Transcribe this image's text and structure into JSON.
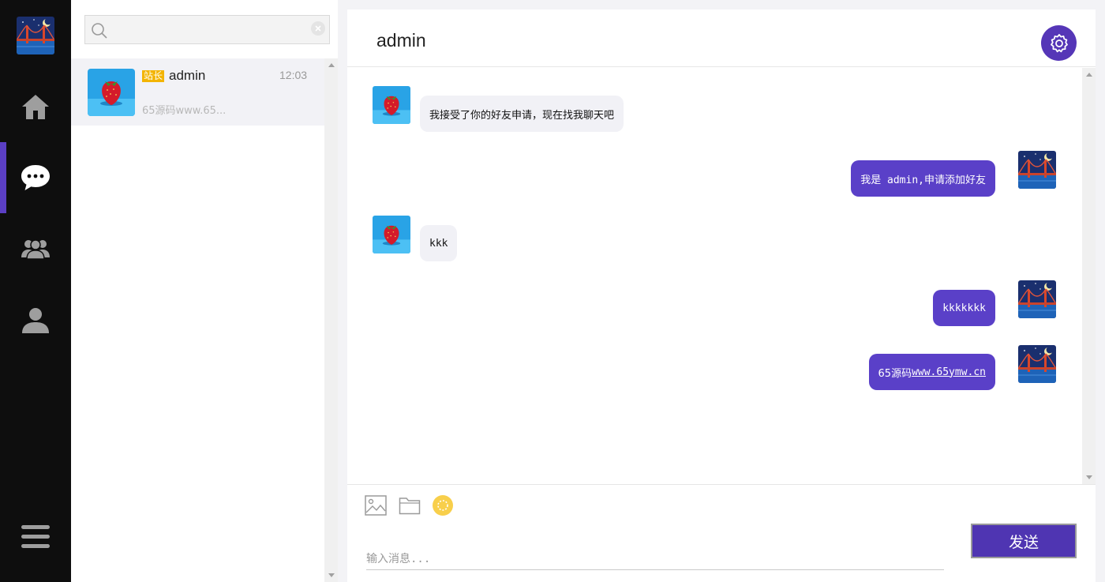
{
  "search": {
    "placeholder": ""
  },
  "conversations": [
    {
      "tag": "站长",
      "name": "admin",
      "time": "12:03",
      "preview": "65源码www.65..."
    }
  ],
  "chat": {
    "title": "admin",
    "messages": [
      {
        "direction": "in",
        "text": "我接受了你的好友申请，现在找我聊天吧"
      },
      {
        "direction": "out",
        "text": "我是 admin,申请添加好友"
      },
      {
        "direction": "in",
        "text": "kkk"
      },
      {
        "direction": "out",
        "text": "kkkkkkk"
      },
      {
        "direction": "out",
        "text_prefix": "65源码",
        "link": "www.65ymw.cn"
      }
    ]
  },
  "composer": {
    "placeholder": "输入消息...",
    "send_label": "发送",
    "tools": [
      "image-icon",
      "folder-icon",
      "emoji-icon"
    ]
  },
  "nav": [
    "home-icon",
    "chat-icon",
    "group-icon",
    "user-icon"
  ],
  "colors": {
    "accent": "#5a40c8",
    "rail": "#0e0e0e",
    "tag": "#f3b400"
  }
}
